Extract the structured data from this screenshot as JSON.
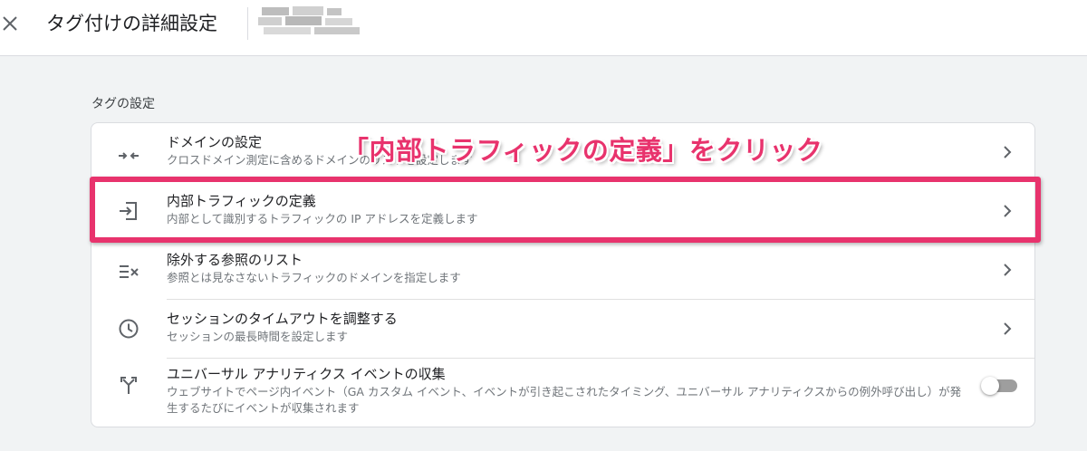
{
  "header": {
    "close_icon": "close-icon",
    "title": "タグ付けの詳細設定"
  },
  "section": {
    "title": "タグの設定"
  },
  "rows": [
    {
      "icon": "merge-arrows-icon",
      "title": "ドメインの設定",
      "description": "クロスドメイン測定に含めるドメインのリストを設定します"
    },
    {
      "icon": "input-arrow-icon",
      "title": "内部トラフィックの定義",
      "description": "内部として識別するトラフィックの IP アドレスを定義します"
    },
    {
      "icon": "exclude-list-icon",
      "title": "除外する参照のリスト",
      "description": "参照とは見なさないトラフィックのドメインを指定します"
    },
    {
      "icon": "clock-icon",
      "title": "セッションのタイムアウトを調整する",
      "description": "セッションの最長時間を設定します"
    },
    {
      "icon": "fork-arrows-icon",
      "title": "ユニバーサル アナリティクス イベントの収集",
      "description": "ウェブサイトでページ内イベント（GA カスタム イベント、イベントが引き起こされたタイミング、ユニバーサル アナリティクスからの例外呼び出し）が発生するたびにイベントが収集されます",
      "toggle_on": false
    }
  ],
  "annotation": {
    "text": "「内部トラフィックの定義」をクリック",
    "color": "#e8336d"
  },
  "colors": {
    "background": "#f1f3f4",
    "card": "#ffffff",
    "accent_highlight": "#e8336d",
    "icon": "#5f6368"
  }
}
